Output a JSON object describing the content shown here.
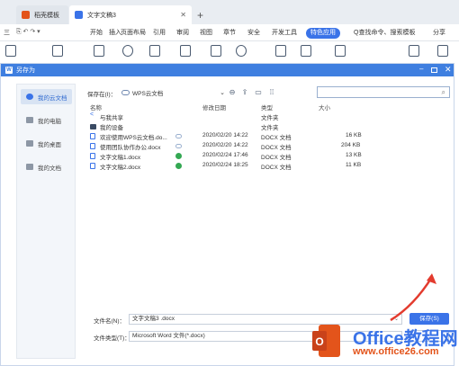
{
  "tabs": [
    {
      "label": "稻壳模板",
      "color": "#e3541b"
    },
    {
      "label": "文字文稿3",
      "color": "#3a73e8"
    }
  ],
  "menu": [
    "三",
    "开始",
    "插入",
    "页面布局",
    "引用",
    "审阅",
    "视图",
    "章节",
    "安全",
    "开发工具"
  ],
  "menu_special": "特色应用",
  "menu_search": "Q查找命令、搜索模板",
  "menu_share": "分享",
  "dialog": {
    "title": "另存为",
    "sidebar": [
      "我的云文档",
      "我的电脑",
      "我的桌面",
      "我的文档"
    ],
    "savein_label": "保存在(I)：",
    "location": "WPS云文档",
    "columns": [
      "名称",
      "修改日期",
      "类型",
      "大小"
    ],
    "rows": [
      {
        "name": "与我共享",
        "date": "",
        "type": "文件夹",
        "size": "",
        "status": ""
      },
      {
        "name": "我的设备",
        "date": "",
        "type": "文件夹",
        "size": "",
        "status": ""
      },
      {
        "name": "欢迎使用WPS云文档.do...",
        "date": "2020/02/20 14:22",
        "type": "DOCX 文档",
        "size": "16 KB",
        "status": "cloud"
      },
      {
        "name": "使用团队协作办公.docx",
        "date": "2020/02/20 14:22",
        "type": "DOCX 文档",
        "size": "204 KB",
        "status": "cloud"
      },
      {
        "name": "文字文稿1.docx",
        "date": "2020/02/24 17:46",
        "type": "DOCX 文档",
        "size": "13 KB",
        "status": "synced"
      },
      {
        "name": "文字文稿2.docx",
        "date": "2020/02/24 18:25",
        "type": "DOCX 文档",
        "size": "11 KB",
        "status": "synced"
      }
    ],
    "filename_label": "文件名(N)：",
    "filename_value": "文字文稿3 .docx",
    "filetype_label": "文件类型(T)：",
    "filetype_value": "Microsoft Word 文件(*.docx)",
    "save_button": "保存(S)"
  },
  "watermark": {
    "brand": "Office教程网",
    "url": "www.office26.com"
  },
  "colors": {
    "accent": "#3a73e8",
    "title_bar": "#3f7fe0",
    "arrow": "#e33b2e"
  }
}
